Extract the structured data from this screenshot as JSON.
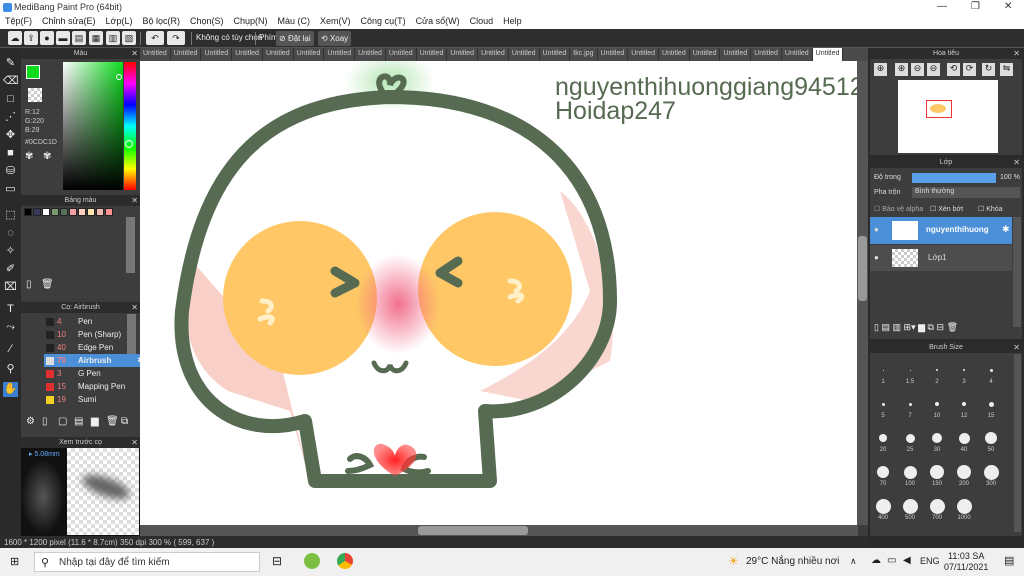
{
  "window": {
    "title": "MediBang Paint Pro (64bit)"
  },
  "menu": [
    "Tệp(F)",
    "Chỉnh sửa(E)",
    "Lớp(L)",
    "Bộ lọc(R)",
    "Chọn(S)",
    "Chụp(N)",
    "Màu (C)",
    "Xem(V)",
    "Công cụ(T)",
    "Cửa sổ(W)",
    "Cloud",
    "Help"
  ],
  "toolbar": {
    "selection_text": "Không có tùy chọn",
    "key_label": "Phím",
    "reset_label": "Đặt lại",
    "rotate_label": "Xoay"
  },
  "tabs": [
    "Untitled",
    "Untitled",
    "Untitled",
    "Untitled",
    "Untitled",
    "Untitled",
    "Untitled",
    "Untitled",
    "Untitled",
    "Untitled",
    "Untitled",
    "Untitled",
    "Untitled",
    "Untitled",
    "tkc.jpg",
    "Untitled",
    "Untitled",
    "Untitled",
    "Untitled",
    "Untitled",
    "Untitled",
    "Untitled",
    "Untitled"
  ],
  "color_panel": {
    "title": "Màu",
    "r": "R:12",
    "g": "G:220",
    "b": "B:29",
    "hex": "#0CDC1D",
    "fg": "#0cdc1d"
  },
  "palette_panel": {
    "title": "Bảng màu",
    "swatches": [
      "#000000",
      "#3a3a5a",
      "#ffffff",
      "#7a9a70",
      "#58705a",
      "#f0a0a0",
      "#ffd0c0",
      "#ffe4b0",
      "#f0b8b0",
      "#ff9090"
    ]
  },
  "brush_panel": {
    "title": "Cọ: Airbrush",
    "items": [
      {
        "num": "4",
        "name": "Pen",
        "color": "#222222"
      },
      {
        "num": "10",
        "name": "Pen (Sharp)",
        "color": "#222222"
      },
      {
        "num": "40",
        "name": "Edge Pen",
        "color": "#222222"
      },
      {
        "num": "70",
        "name": "Airbrush",
        "color": "#dddddd"
      },
      {
        "num": "3",
        "name": "G Pen",
        "color": "#e03030"
      },
      {
        "num": "15",
        "name": "Mapping Pen",
        "color": "#e03030"
      },
      {
        "num": "19",
        "name": "Sumi",
        "color": "#f0d020"
      }
    ]
  },
  "preview_panel": {
    "title": "Xem trước cọ",
    "size": "5.08mm"
  },
  "navigator_panel": {
    "title": "Hoa tiêu"
  },
  "layer_panel": {
    "title": "Lớp",
    "opacity_label": "Độ trong",
    "opacity_value": "100 %",
    "blend_label": "Pha trộn",
    "blend_value": "Bình thường",
    "protect_alpha": "Bảo vệ alpha",
    "clipping": "Xén bớt",
    "lock": "Khóa",
    "layers": [
      {
        "name": "nguyenthihuong"
      },
      {
        "name": "Lớp1"
      }
    ]
  },
  "brush_size_panel": {
    "title": "Brush Size",
    "rows": [
      [
        "1",
        "1.5",
        "2",
        "3",
        "4"
      ],
      [
        "5",
        "7",
        "10",
        "12",
        "15"
      ],
      [
        "20",
        "25",
        "30",
        "40",
        "50"
      ],
      [
        "70",
        "100",
        "150",
        "200",
        "300"
      ],
      [
        "400",
        "500",
        "700",
        "1000"
      ]
    ]
  },
  "canvas_text": {
    "line1": "nguyenthihuonggiang94512",
    "line2": "Hoidap247"
  },
  "status": {
    "size": "1600 * 1200 pixel",
    "dims": "(11.6 * 8.7cm)",
    "dpi": "350 dpi",
    "zoom": "300 %",
    "coords": "( 599, 637 )"
  },
  "taskbar": {
    "search_placeholder": "Nhập tại đây để tìm kiếm",
    "weather": "29°C  Nắng nhiều nơi",
    "lang": "ENG",
    "time": "11:03 SA",
    "date": "07/11/2021"
  }
}
